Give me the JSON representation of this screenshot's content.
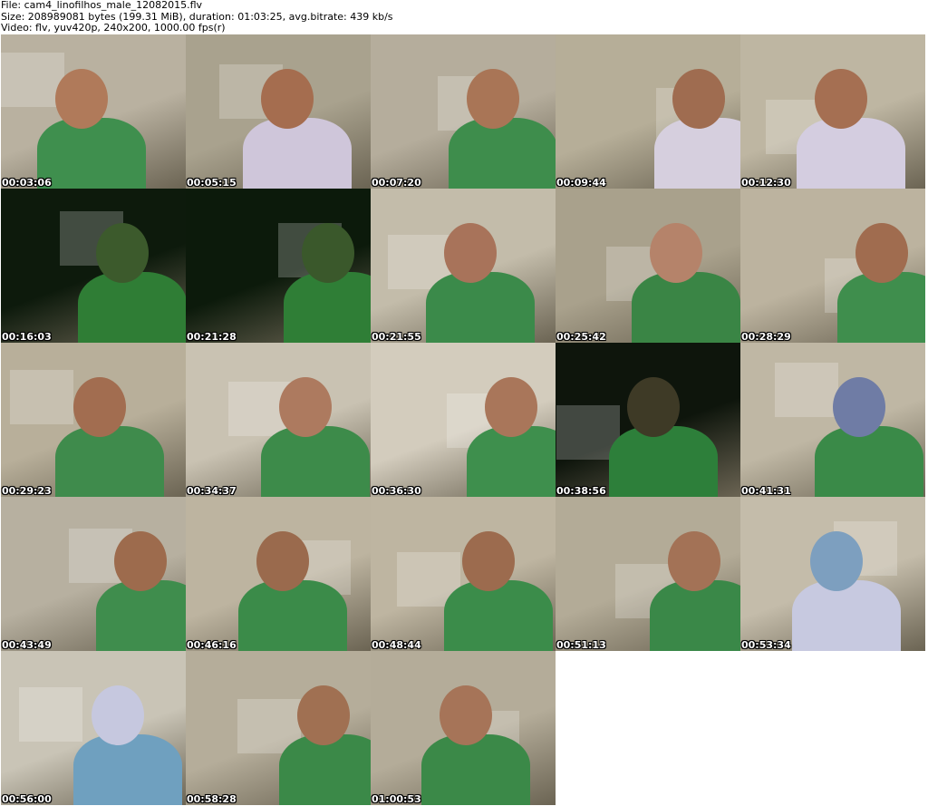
{
  "header": {
    "file_line": "File: cam4_linofilhos_male_12082015.flv",
    "size_line": "Size: 208989081 bytes (199.31 MiB), duration: 01:03:25, avg.bitrate: 439 kb/s",
    "video_line": "Video: flv, yuv420p, 240x200, 1000.00 fps(r)"
  },
  "thumbnails": [
    {
      "time": "00:03:06",
      "bg": "#b9b1a0",
      "accent": "#3f8f4e",
      "face": "#b07a5a"
    },
    {
      "time": "00:05:15",
      "bg": "#a9a28e",
      "accent": "#cfc6da",
      "face": "#a56d4f"
    },
    {
      "time": "00:07:20",
      "bg": "#b5ad9c",
      "accent": "#3e8d4c",
      "face": "#a97556"
    },
    {
      "time": "00:09:44",
      "bg": "#b6ae98",
      "accent": "#d6cfde",
      "face": "#9f6c50"
    },
    {
      "time": "00:12:30",
      "bg": "#beb6a2",
      "accent": "#d4cde0",
      "face": "#a56f52"
    },
    {
      "time": "00:16:03",
      "bg": "#0d1a0c",
      "accent": "#2f7d35",
      "face": "#3c5a2c"
    },
    {
      "time": "00:21:28",
      "bg": "#0c1a0b",
      "accent": "#2f7e36",
      "face": "#3a582b"
    },
    {
      "time": "00:21:55",
      "bg": "#c3bcaa",
      "accent": "#3b8a4a",
      "face": "#a8735a"
    },
    {
      "time": "00:25:42",
      "bg": "#a9a18c",
      "accent": "#3a8545",
      "face": "#b5836a"
    },
    {
      "time": "00:28:29",
      "bg": "#bcb39f",
      "accent": "#3f8e4d",
      "face": "#a06c4f"
    },
    {
      "time": "00:29:23",
      "bg": "#b8af9a",
      "accent": "#3f8b4c",
      "face": "#a26d50"
    },
    {
      "time": "00:34:37",
      "bg": "#c9c2b2",
      "accent": "#3d8b4a",
      "face": "#ad7a5f"
    },
    {
      "time": "00:36:30",
      "bg": "#d3ccbd",
      "accent": "#3e8f4d",
      "face": "#a9765a"
    },
    {
      "time": "00:38:56",
      "bg": "#0e150c",
      "accent": "#2d7f3a",
      "face": "#3e3a26"
    },
    {
      "time": "00:41:31",
      "bg": "#bfb7a4",
      "accent": "#3a8a48",
      "face": "#6f7ca5"
    },
    {
      "time": "00:43:49",
      "bg": "#b7b0a0",
      "accent": "#3f8d4d",
      "face": "#9d6b4d"
    },
    {
      "time": "00:46:16",
      "bg": "#bdb4a0",
      "accent": "#3b8b49",
      "face": "#9a6a4d"
    },
    {
      "time": "00:48:44",
      "bg": "#beb5a1",
      "accent": "#3b8c4a",
      "face": "#9c6b4e"
    },
    {
      "time": "00:51:13",
      "bg": "#b3ab97",
      "accent": "#3a8848",
      "face": "#a37256"
    },
    {
      "time": "00:53:34",
      "bg": "#c4bcaa",
      "accent": "#c7c9e0",
      "face": "#7d9fbf"
    },
    {
      "time": "00:56:00",
      "bg": "#c9c4b6",
      "accent": "#6fa0bf",
      "face": "#c6c8df"
    },
    {
      "time": "00:58:28",
      "bg": "#b5ad9a",
      "accent": "#3b8948",
      "face": "#a07052"
    },
    {
      "time": "01:00:53",
      "bg": "#b4ac99",
      "accent": "#3b8948",
      "face": "#a67458"
    }
  ]
}
